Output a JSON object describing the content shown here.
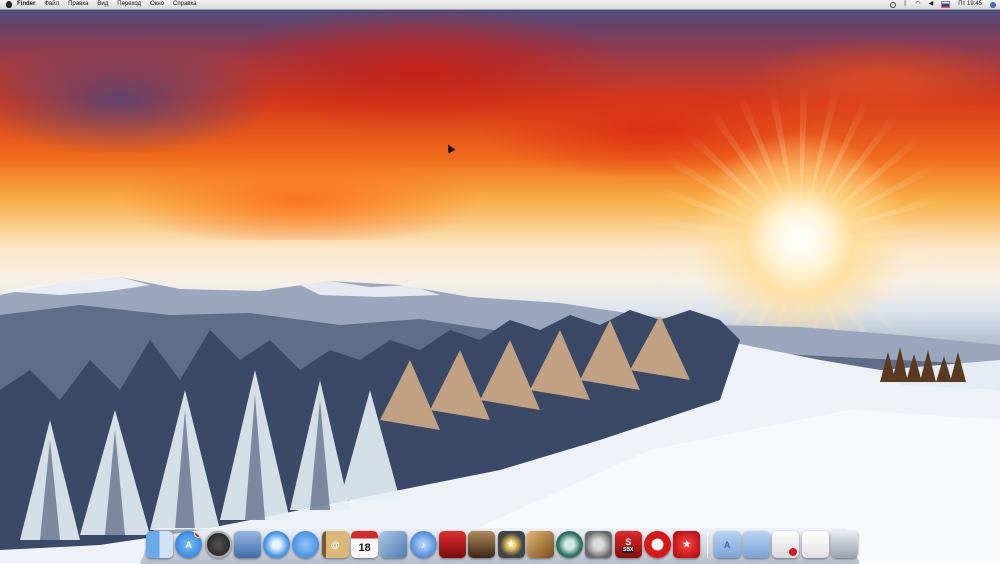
{
  "menubar": {
    "app_name": "Finder",
    "items": [
      "Файл",
      "Правка",
      "Вид",
      "Переход",
      "Окно",
      "Справка"
    ],
    "clock": "Пт 19:45"
  },
  "dock": {
    "apps": [
      {
        "name": "finder",
        "icon": "finder-icon",
        "color": "#4a90d9"
      },
      {
        "name": "app-store",
        "icon": "app-store-icon",
        "color": "#2f7fe0",
        "badge": "4"
      },
      {
        "name": "dashboard",
        "icon": "dashboard-icon",
        "color": "#2b2b2b"
      },
      {
        "name": "preview",
        "icon": "preview-icon",
        "color": "#5b7fb0"
      },
      {
        "name": "safari",
        "icon": "safari-icon",
        "color": "#3a8fe0"
      },
      {
        "name": "ichat",
        "icon": "ichat-icon",
        "color": "#3b86d9"
      },
      {
        "name": "address-book",
        "icon": "address-book-icon",
        "color": "#b58a4a"
      },
      {
        "name": "ical",
        "icon": "ical-icon",
        "color": "#f2f2f2",
        "label": "18"
      },
      {
        "name": "iphoto",
        "icon": "iphoto-icon",
        "color": "#6b8fc0"
      },
      {
        "name": "itunes",
        "icon": "itunes-icon",
        "color": "#2a6fd6"
      },
      {
        "name": "photo-booth",
        "icon": "photo-booth-icon",
        "color": "#b01515"
      },
      {
        "name": "image-capture",
        "icon": "image-capture-icon",
        "color": "#6a4a2a"
      },
      {
        "name": "imovie",
        "icon": "imovie-icon",
        "color": "#3a3a3a"
      },
      {
        "name": "garageband",
        "icon": "garageband-icon",
        "color": "#8a6a3a"
      },
      {
        "name": "time-machine",
        "icon": "time-machine-icon",
        "color": "#2f6f60"
      },
      {
        "name": "system-preferences",
        "icon": "gear-icon",
        "color": "#8a8a8a"
      },
      {
        "name": "sandboxie",
        "icon": "sandbox-icon",
        "color": "#c01818",
        "label": "SBX"
      },
      {
        "name": "opera",
        "icon": "opera-icon",
        "color": "#d81818"
      },
      {
        "name": "pokerstars",
        "icon": "pokerstars-icon",
        "color": "#d02020"
      }
    ],
    "stacks": [
      {
        "name": "applications",
        "icon": "folder-applications-icon",
        "color": "#8fb4e0"
      },
      {
        "name": "documents",
        "icon": "folder-documents-icon",
        "color": "#8fb4e0"
      },
      {
        "name": "downloads",
        "icon": "downloads-icon",
        "color": "#e8e8e8"
      },
      {
        "name": "document-stack",
        "icon": "document-icon",
        "color": "#f0f0f0"
      },
      {
        "name": "trash",
        "icon": "trash-icon",
        "color": "#c8ccd2"
      }
    ]
  },
  "colors": {
    "menubar_bg": "#e6e6e6",
    "sky_top": "#3d4f86",
    "sunset_red": "#d63a1a",
    "snow": "#f3f6fa"
  }
}
